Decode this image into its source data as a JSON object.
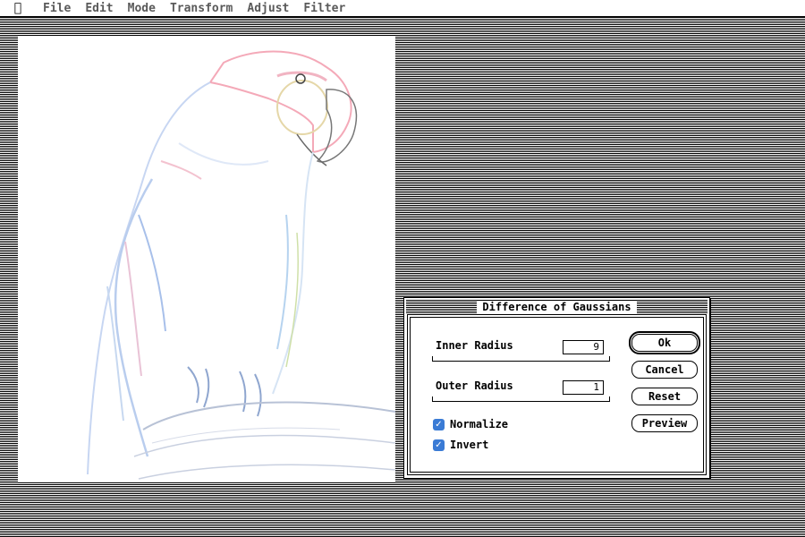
{
  "menubar": {
    "apple_icon": "",
    "items": [
      "File",
      "Edit",
      "Mode",
      "Transform",
      "Adjust",
      "Filter"
    ]
  },
  "document": {
    "image": "parrot-sketch"
  },
  "dialog": {
    "title": "Difference of Gaussians",
    "inner_radius": {
      "label": "Inner Radius",
      "value": "9"
    },
    "outer_radius": {
      "label": "Outer Radius",
      "value": "1"
    },
    "normalize": {
      "label": "Normalize",
      "checked": true
    },
    "invert": {
      "label": "Invert",
      "checked": true
    },
    "buttons": {
      "ok": "Ok",
      "cancel": "Cancel",
      "reset": "Reset",
      "preview": "Preview"
    }
  },
  "colors": {
    "checkbox": "#3a7bd5"
  }
}
